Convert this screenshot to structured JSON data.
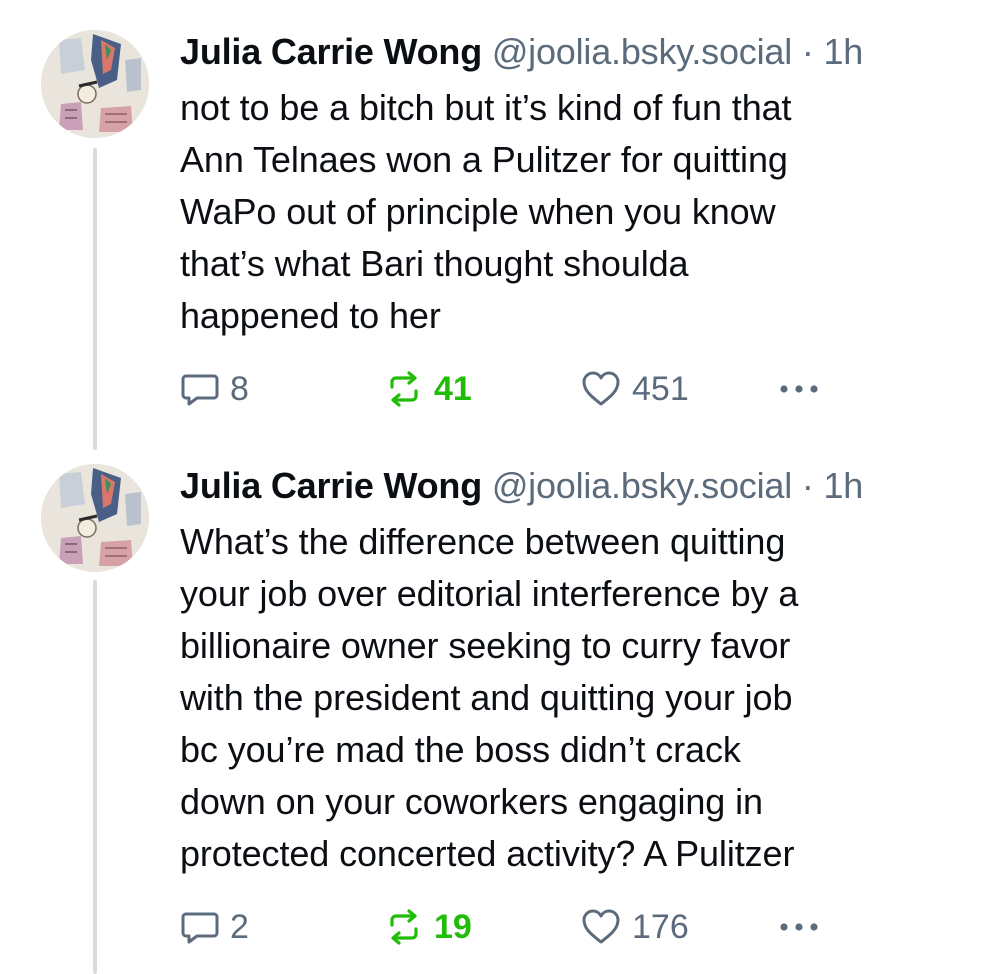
{
  "posts": [
    {
      "author": "Julia Carrie Wong",
      "handle": "@joolia.bsky.social",
      "separator": "·",
      "time": "1h",
      "text_lines": [
        "not to be a bitch but it’s kind of fun that",
        "Ann Telnaes won a Pulitzer for quitting",
        "WaPo out of principle when you know",
        "that’s what Bari thought shoulda",
        "happened to her"
      ],
      "replies": "8",
      "reposts": "41",
      "likes": "451"
    },
    {
      "author": "Julia Carrie Wong",
      "handle": "@joolia.bsky.social",
      "separator": "·",
      "time": "1h",
      "text_lines": [
        "What’s the difference between quitting",
        "your job over editorial interference by a",
        "billionaire owner seeking to curry favor",
        "with the president and quitting your job",
        "bc you’re mad the boss didn’t crack",
        "down on your coworkers engaging in",
        "protected concerted activity? A Pulitzer"
      ],
      "replies": "2",
      "reposts": "19",
      "likes": "176"
    }
  ],
  "icons": {
    "reply": "reply-bubble-icon",
    "repost": "repost-icon",
    "like": "heart-icon",
    "more": "ellipsis-icon"
  },
  "colors": {
    "text": "#0b0f14",
    "muted": "#5b6b7c",
    "repost_active": "#20bc07",
    "thread_line": "#d4dbe2"
  }
}
